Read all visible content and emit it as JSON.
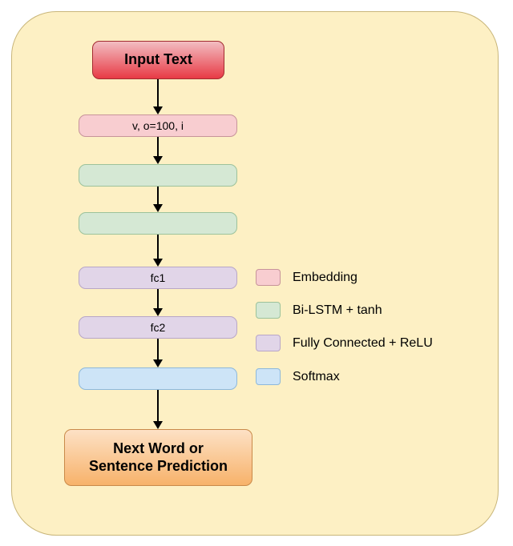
{
  "diagram": {
    "input": "Input Text",
    "embedding_label": "v, o=100, i",
    "fc1_label": "fc1",
    "fc2_label": "fc2",
    "output": "Next Word or\nSentence Prediction"
  },
  "legend": {
    "embedding": "Embedding",
    "bilstm": "Bi-LSTM + tanh",
    "fc": "Fully Connected + ReLU",
    "softmax": "Softmax"
  },
  "colors": {
    "canvas_bg": "#fdf0c4",
    "embedding": "#f8cdd0",
    "bilstm": "#d5e8d4",
    "fc": "#e1d5e8",
    "softmax": "#cde4f7",
    "input_grad_top": "#f2bdc1",
    "input_grad_bot": "#e83a45",
    "output_grad_top": "#fde1c5",
    "output_grad_bot": "#f7b26a"
  }
}
